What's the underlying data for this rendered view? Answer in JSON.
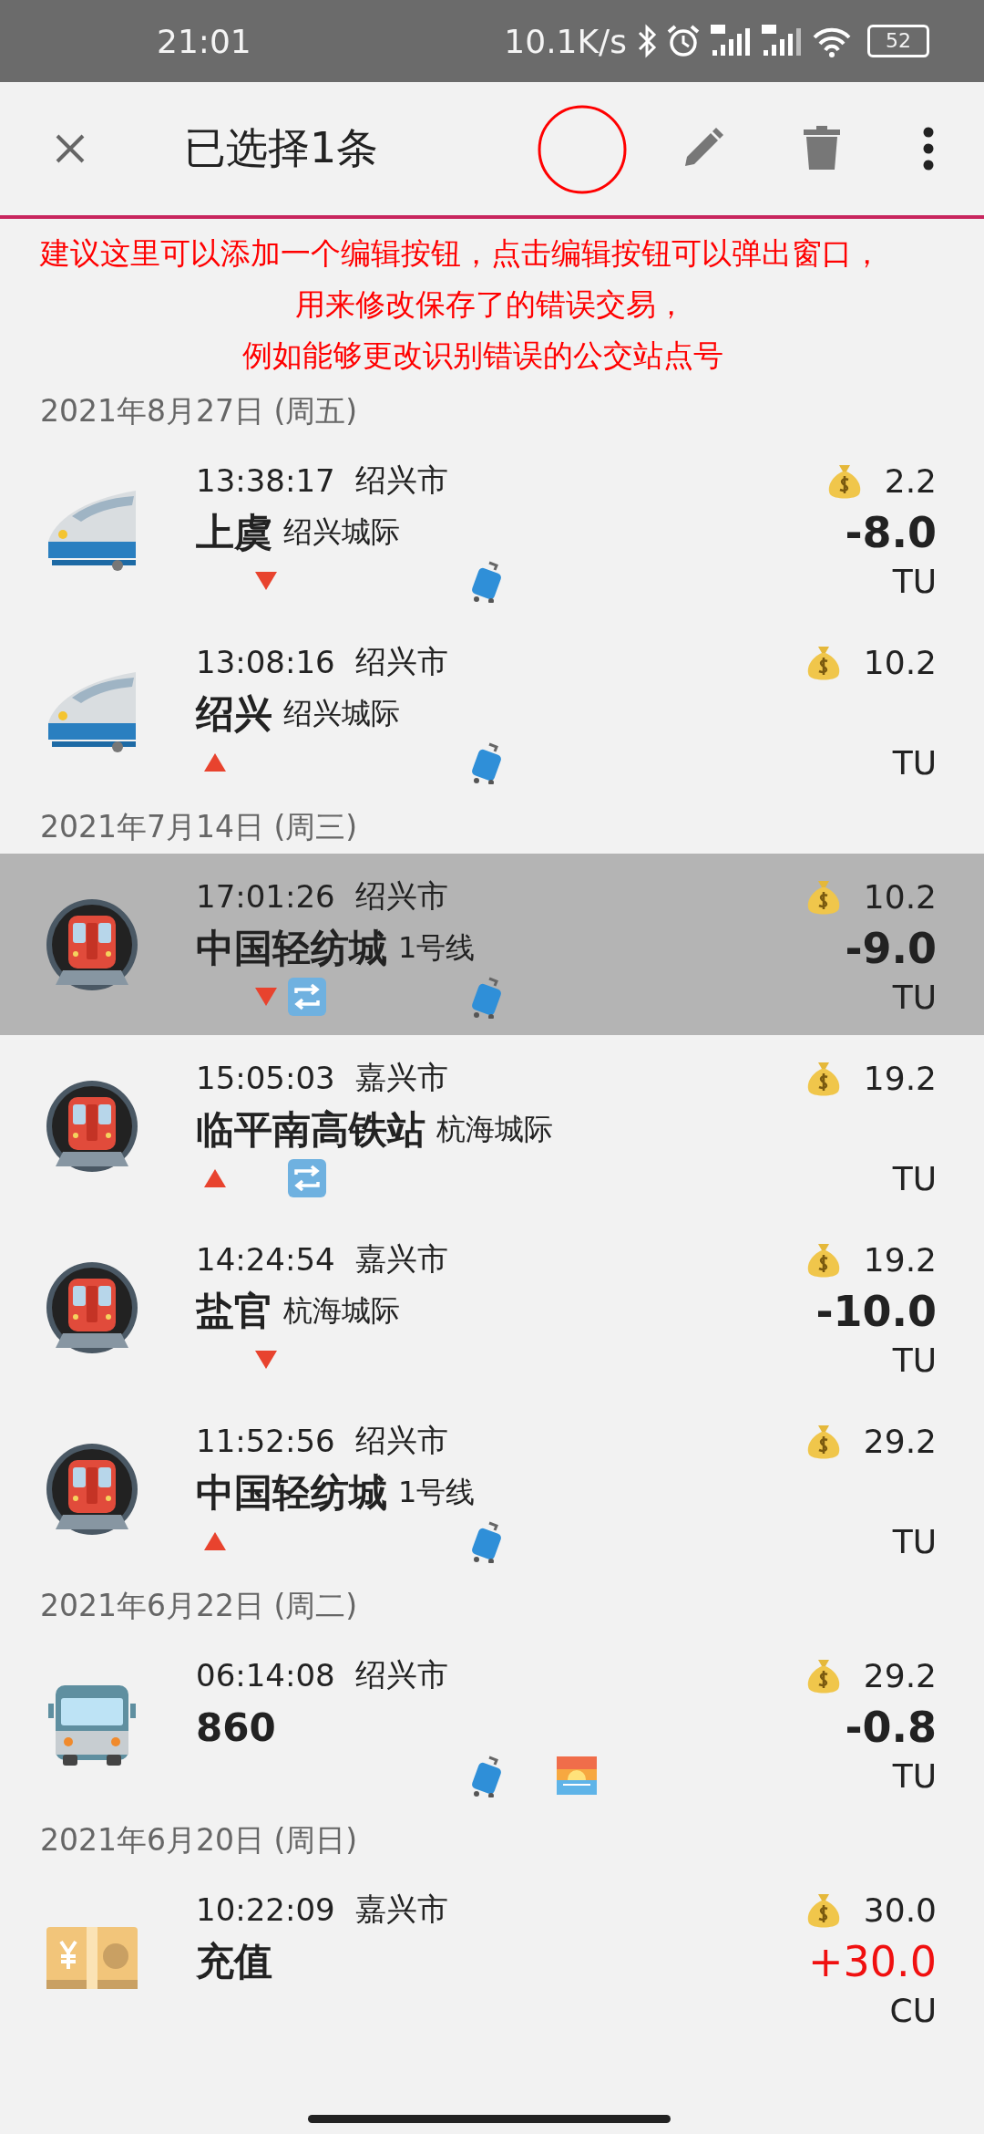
{
  "status_bar": {
    "time": "21:01",
    "speed": "10.1K/s",
    "battery": "52"
  },
  "toolbar": {
    "title": "已选择1条"
  },
  "annotation": {
    "lines": [
      "建议这里可以添加一个编辑按钮，点击编辑按钮可以弹出窗口，",
      "用来修改保存了的错误交易，",
      "例如能够更改识别错误的公交站点号"
    ]
  },
  "groups": [
    {
      "date": "2021年8月27日 (周五)",
      "rows": [
        {
          "kind": "rail",
          "selected": false,
          "time": "13:38:17",
          "city": "绍兴市",
          "name": "上虞",
          "line": "绍兴城际",
          "balance": "2.2",
          "amount": "-8.0",
          "unit": "TU",
          "boarding": false,
          "alighting": true,
          "transfer": false,
          "luggage": true,
          "sunrise": false
        },
        {
          "kind": "rail",
          "selected": false,
          "time": "13:08:16",
          "city": "绍兴市",
          "name": "绍兴",
          "line": "绍兴城际",
          "balance": "10.2",
          "unit": "TU",
          "boarding": true,
          "alighting": false,
          "transfer": false,
          "luggage": true,
          "sunrise": false
        }
      ]
    },
    {
      "date": "2021年7月14日 (周三)",
      "rows": [
        {
          "kind": "metro",
          "selected": true,
          "time": "17:01:26",
          "city": "绍兴市",
          "name": "中国轻纺城",
          "line": "1号线",
          "balance": "10.2",
          "amount": "-9.0",
          "unit": "TU",
          "boarding": false,
          "alighting": true,
          "transfer": true,
          "luggage": true,
          "sunrise": false
        },
        {
          "kind": "metro",
          "selected": false,
          "time": "15:05:03",
          "city": "嘉兴市",
          "name": "临平南高铁站",
          "line": "杭海城际",
          "balance": "19.2",
          "unit": "TU",
          "boarding": true,
          "alighting": false,
          "transfer": true,
          "luggage": false,
          "sunrise": false
        },
        {
          "kind": "metro",
          "selected": false,
          "time": "14:24:54",
          "city": "嘉兴市",
          "name": "盐官",
          "line": "杭海城际",
          "balance": "19.2",
          "amount": "-10.0",
          "unit": "TU",
          "boarding": false,
          "alighting": true,
          "transfer": false,
          "luggage": false,
          "sunrise": false
        },
        {
          "kind": "metro",
          "selected": false,
          "time": "11:52:56",
          "city": "绍兴市",
          "name": "中国轻纺城",
          "line": "1号线",
          "balance": "29.2",
          "unit": "TU",
          "boarding": true,
          "alighting": false,
          "transfer": false,
          "luggage": true,
          "sunrise": false
        }
      ]
    },
    {
      "date": "2021年6月22日 (周二)",
      "rows": [
        {
          "kind": "bus",
          "selected": false,
          "time": "06:14:08",
          "city": "绍兴市",
          "name": "860",
          "balance": "29.2",
          "amount": "-0.8",
          "unit": "TU",
          "boarding": false,
          "alighting": false,
          "transfer": false,
          "luggage": true,
          "sunrise": true
        }
      ]
    },
    {
      "date": "2021年6月20日 (周日)",
      "rows": [
        {
          "kind": "topup",
          "selected": false,
          "time": "10:22:09",
          "city": "嘉兴市",
          "name": "充值",
          "balance": "30.0",
          "amount": "+30.0",
          "unit": "CU",
          "boarding": false,
          "alighting": false,
          "transfer": false,
          "luggage": false,
          "sunrise": false
        }
      ]
    }
  ]
}
